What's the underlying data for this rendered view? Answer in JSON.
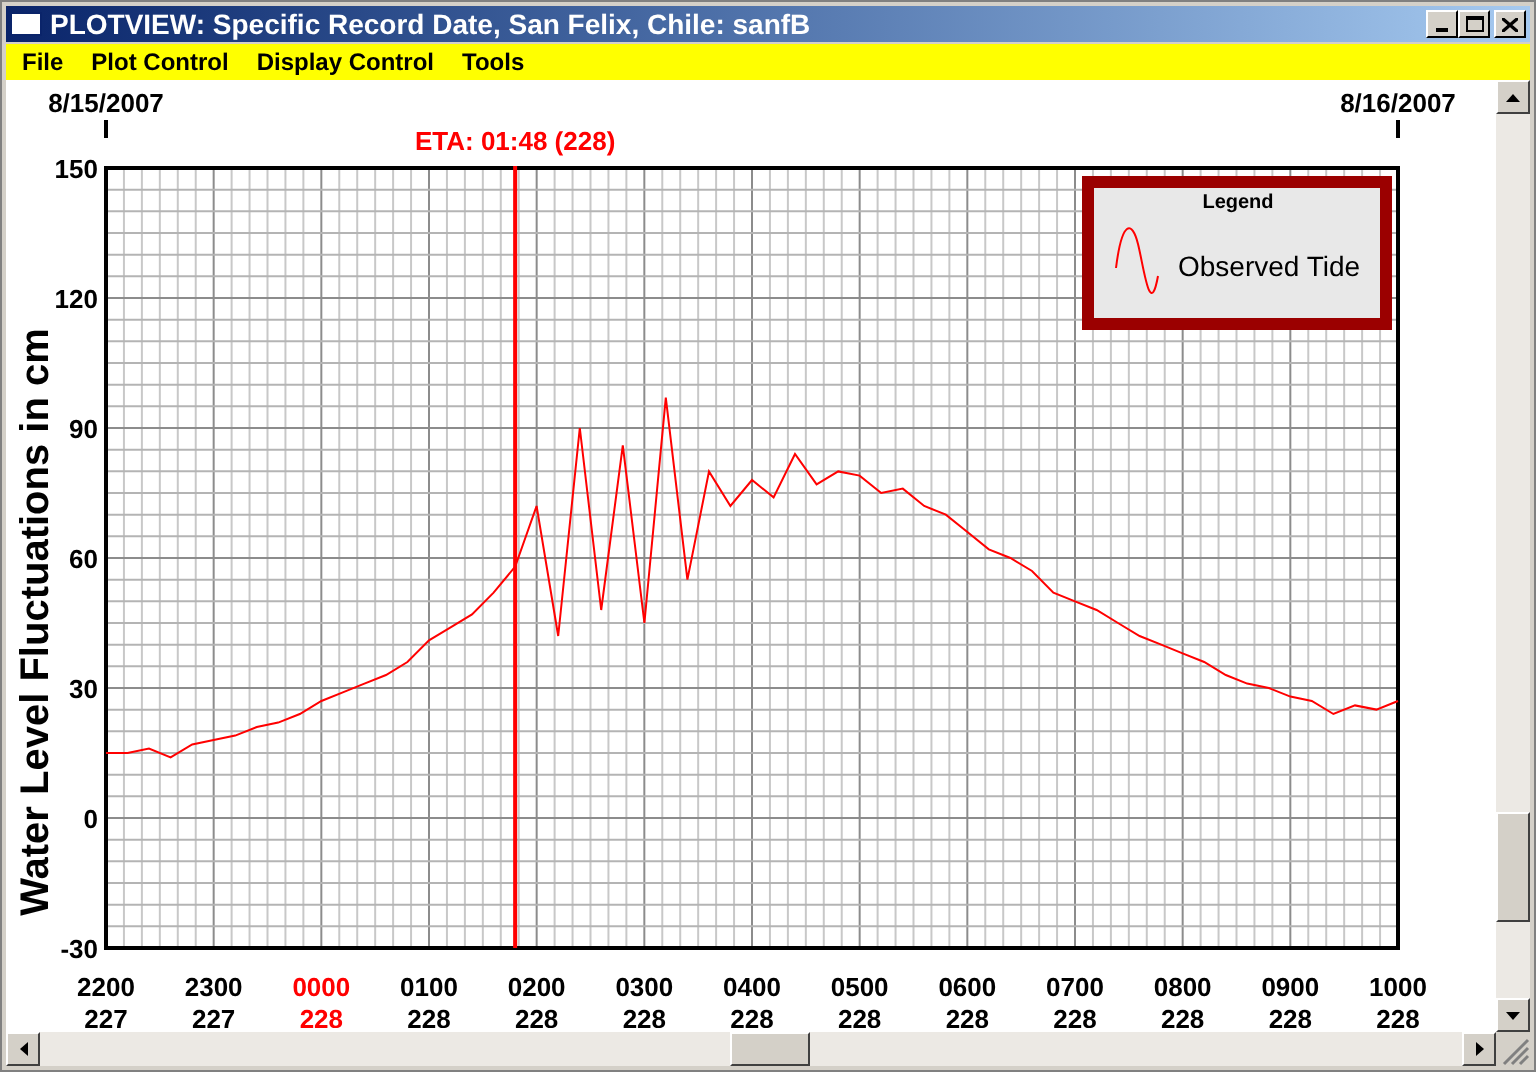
{
  "window": {
    "title": "PLOTVIEW: Specific Record Date, San Felix, Chile: sanfB"
  },
  "menu": [
    {
      "label": "File"
    },
    {
      "label": "Plot Control"
    },
    {
      "label": "Display Control"
    },
    {
      "label": "Tools"
    }
  ],
  "plot": {
    "date_labels": [
      "8/15/2007",
      "8/16/2007"
    ],
    "legend": {
      "title": "Legend"
    },
    "tick_days": [
      {
        "day": "227",
        "highlighted": false
      },
      {
        "day": "227",
        "highlighted": false
      },
      {
        "day": "228",
        "highlighted": true
      },
      {
        "day": "228",
        "highlighted": false
      },
      {
        "day": "228",
        "highlighted": false
      },
      {
        "day": "228",
        "highlighted": false
      },
      {
        "day": "228",
        "highlighted": false
      },
      {
        "day": "228",
        "highlighted": false
      },
      {
        "day": "228",
        "highlighted": false
      },
      {
        "day": "228",
        "highlighted": false
      },
      {
        "day": "228",
        "highlighted": false
      },
      {
        "day": "228",
        "highlighted": false
      },
      {
        "day": "228",
        "highlighted": false
      }
    ],
    "eta_marker": {
      "prefix": "ETA:",
      "time": "01:48",
      "suffix": "(228)",
      "color": "#ff0000"
    },
    "chart_data": {
      "type": "line",
      "grid": true,
      "ylabel": "Water Level Fluctuations in cm",
      "ylim": [
        -30,
        150
      ],
      "yticks": [
        -30,
        0,
        30,
        60,
        90,
        120,
        150
      ],
      "categories": [
        "2200",
        null,
        null,
        null,
        null,
        "2300",
        null,
        null,
        null,
        null,
        "0000",
        null,
        null,
        null,
        null,
        "0100",
        null,
        null,
        null,
        null,
        "0200",
        null,
        null,
        null,
        null,
        "0300",
        null,
        null,
        null,
        null,
        "0400",
        null,
        null,
        null,
        null,
        "0500",
        null,
        null,
        null,
        null,
        "0600",
        null,
        null,
        null,
        null,
        "0700",
        null,
        null,
        null,
        null,
        "0800",
        null,
        null,
        null,
        null,
        "0900",
        null,
        null,
        null,
        null,
        "1000"
      ],
      "series": [
        {
          "name": "Observed Tide",
          "color": "#ff0000",
          "values": [
            15,
            15,
            16,
            14,
            17,
            18,
            19,
            21,
            22,
            24,
            27,
            29,
            31,
            33,
            36,
            41,
            44,
            47,
            52,
            58,
            72,
            42,
            90,
            48,
            86,
            45,
            97,
            55,
            80,
            72,
            78,
            74,
            84,
            77,
            80,
            79,
            75,
            76,
            72,
            70,
            66,
            62,
            60,
            57,
            52,
            50,
            48,
            45,
            42,
            40,
            38,
            36,
            33,
            31,
            30,
            28,
            27,
            24,
            26,
            25,
            27
          ]
        }
      ]
    }
  }
}
